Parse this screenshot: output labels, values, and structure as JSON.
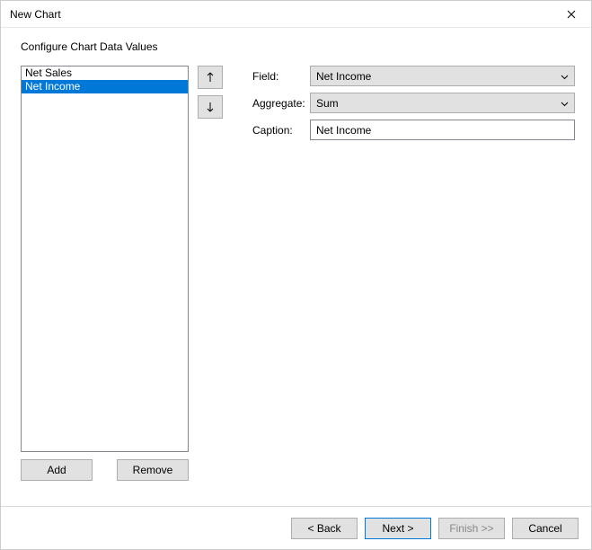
{
  "window": {
    "title": "New Chart"
  },
  "subtitle": "Configure Chart Data Values",
  "list": {
    "items": [
      {
        "label": "Net Sales",
        "selected": false
      },
      {
        "label": "Net Income",
        "selected": true
      }
    ]
  },
  "buttons": {
    "add": "Add",
    "remove": "Remove"
  },
  "form": {
    "field_label": "Field:",
    "field_value": "Net Income",
    "aggregate_label": "Aggregate:",
    "aggregate_value": "Sum",
    "caption_label": "Caption:",
    "caption_value": "Net Income"
  },
  "footer": {
    "back": "< Back",
    "next": "Next >",
    "finish": "Finish >>",
    "cancel": "Cancel"
  }
}
